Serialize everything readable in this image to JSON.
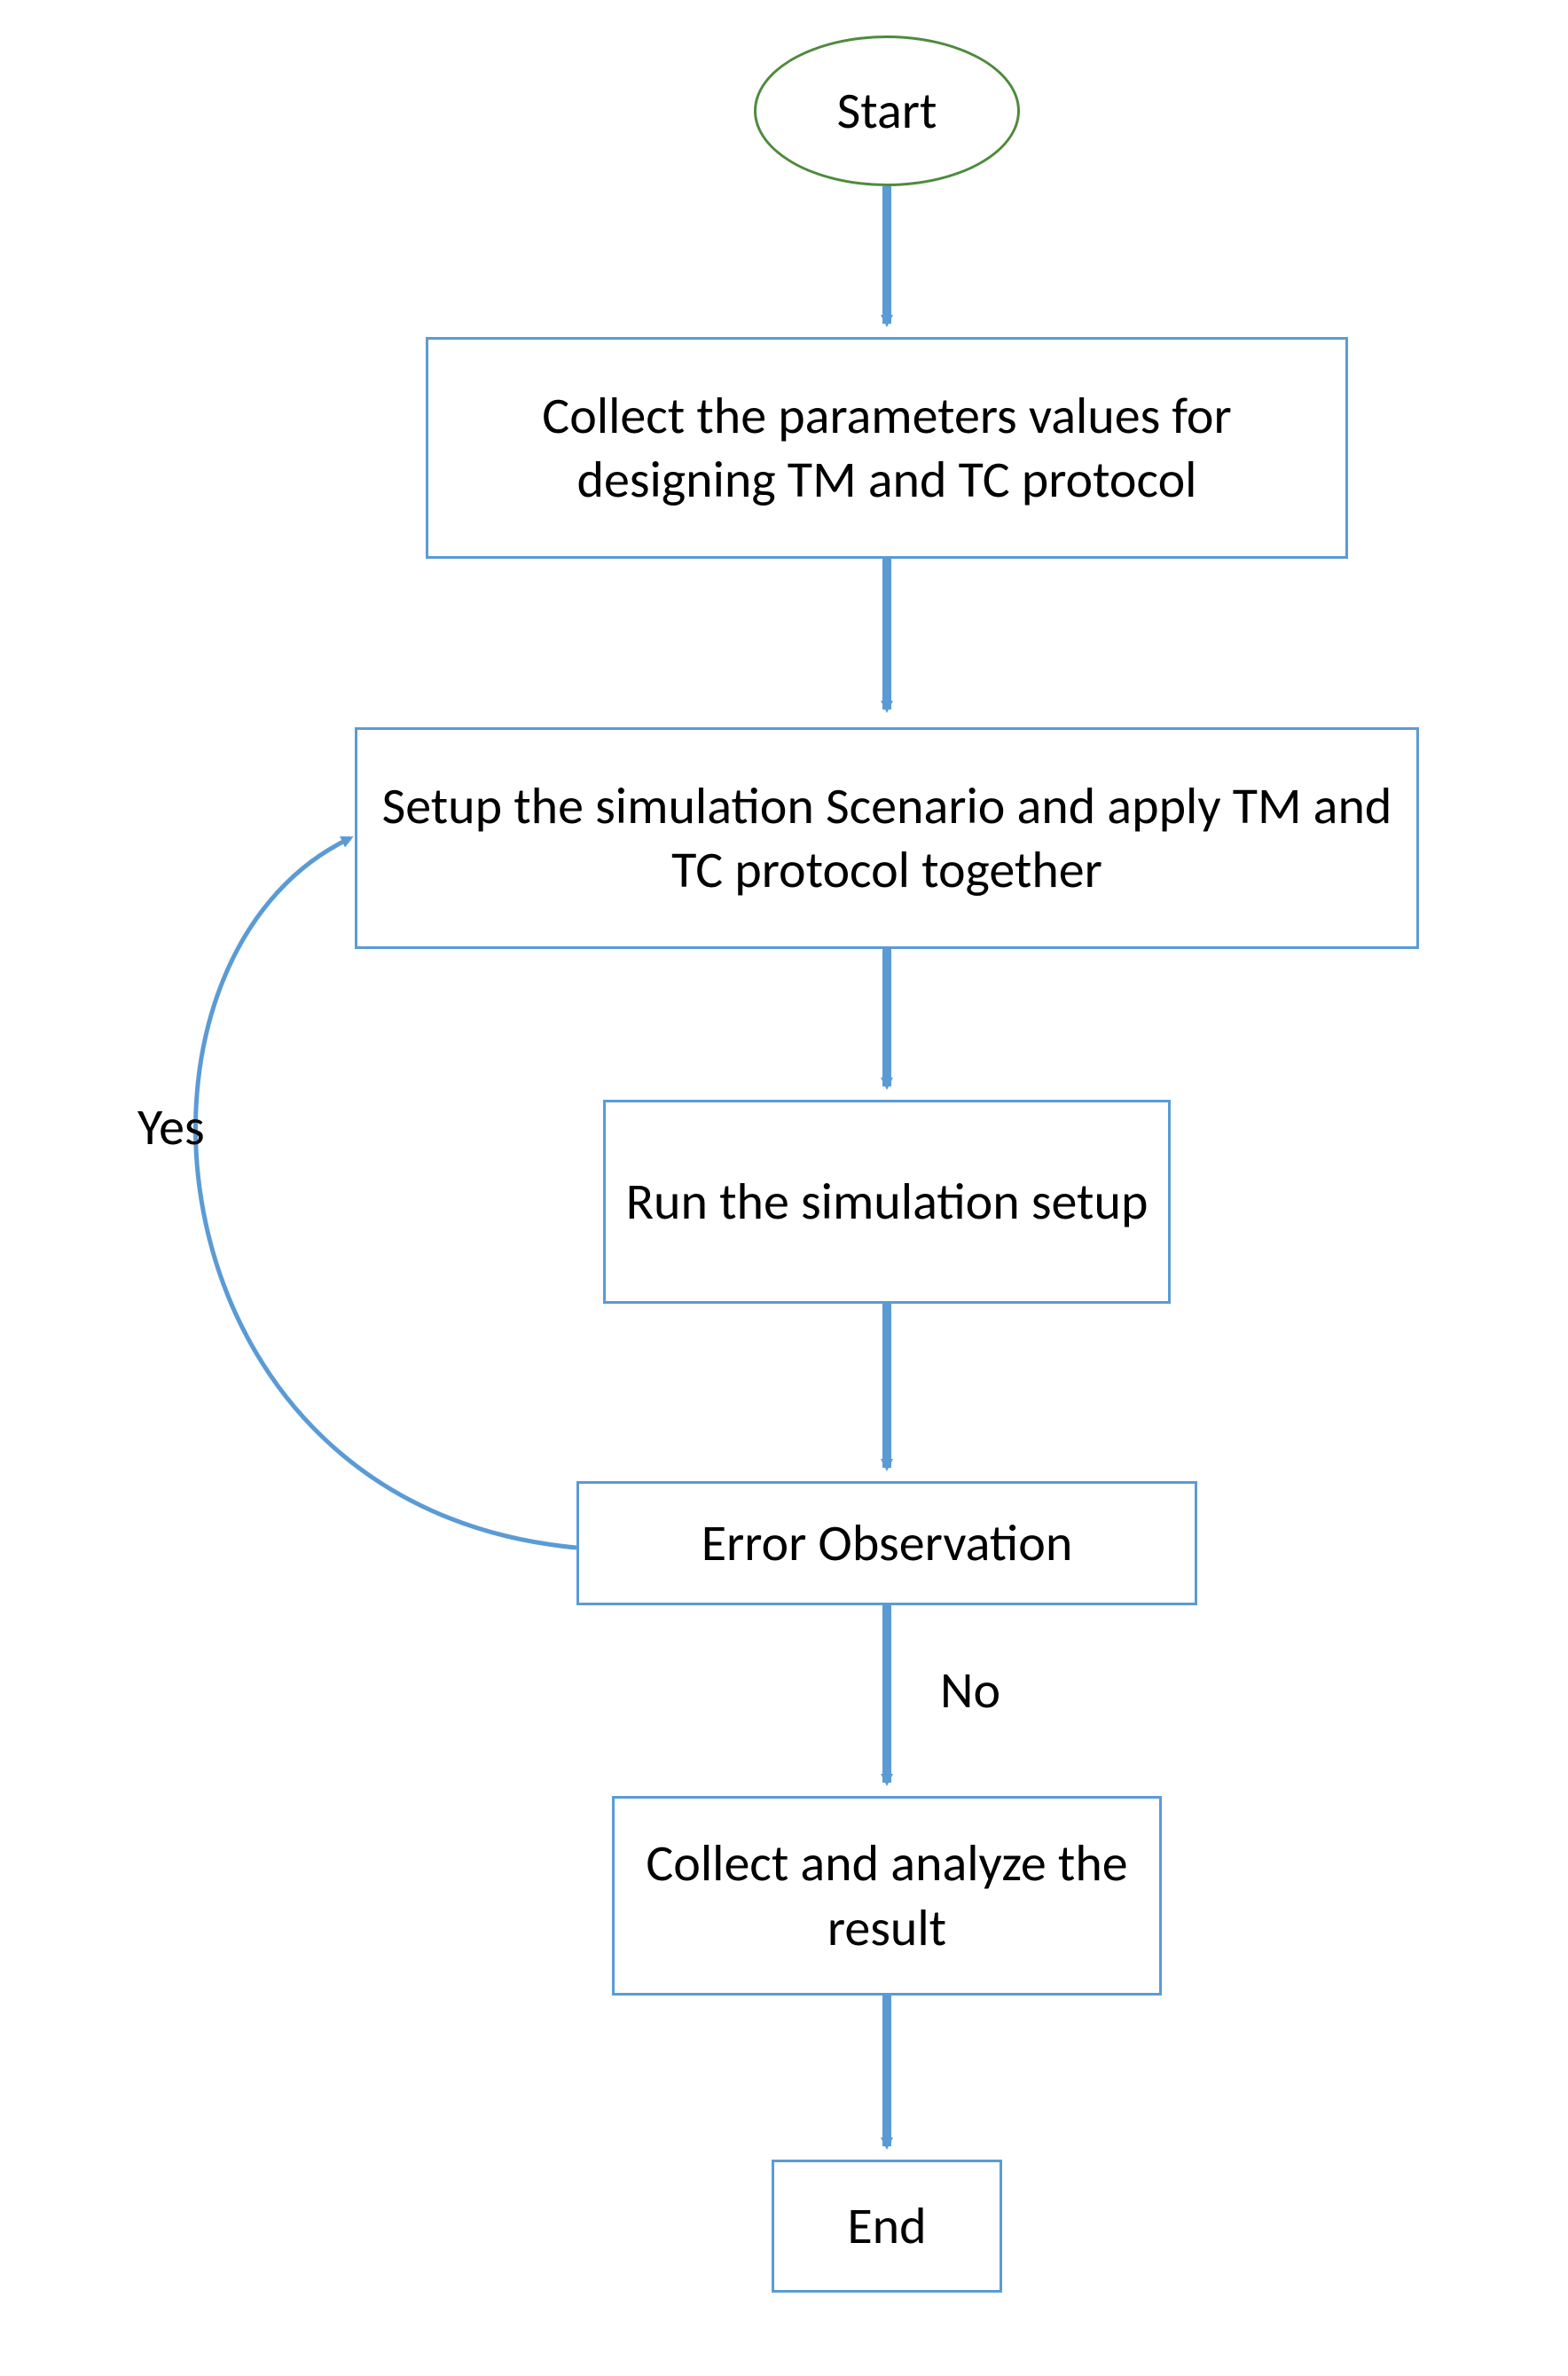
{
  "nodes": {
    "start": {
      "text": "Start"
    },
    "collect": {
      "text": "Collect the parameters values for designing TM and TC protocol"
    },
    "setup": {
      "text": "Setup the simulation Scenario and apply TM  and TC protocol together"
    },
    "run": {
      "text": "Run the simulation setup"
    },
    "error": {
      "text": "Error Observation"
    },
    "analyze": {
      "text": "Collect and analyze the result"
    },
    "end": {
      "text": "End"
    }
  },
  "labels": {
    "yes": "Yes",
    "no": "No"
  },
  "colors": {
    "box_border": "#5b9bd5",
    "arrow": "#5b9bd5",
    "start_border": "#4f8a3d",
    "text": "#000000"
  }
}
